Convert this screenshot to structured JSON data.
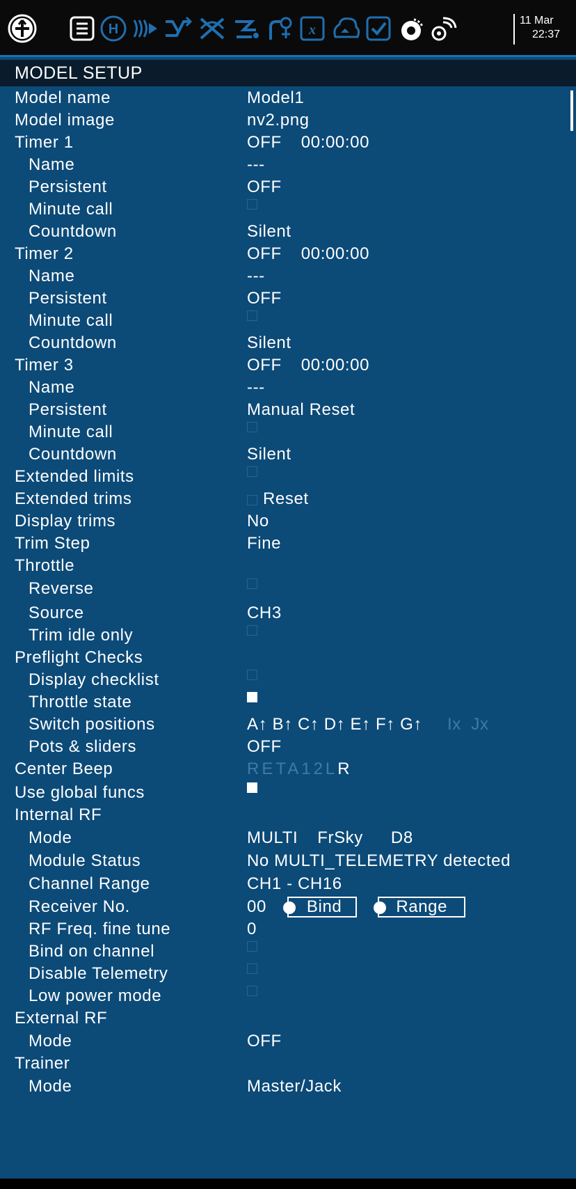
{
  "topbar": {
    "icons": [
      "radio-menu-icon",
      "model-menu-icon",
      "heli-icon",
      "outputs-icon",
      "mixes-icon",
      "curves-icon",
      "logical-switches-icon",
      "special-functions-icon",
      "gvars-icon",
      "lua-scripts-icon",
      "telemetry-icon",
      "checklist-icon",
      "display-icon",
      "telemetry-signal-icon"
    ],
    "date": "11 Mar",
    "time": "22:37"
  },
  "header": {
    "title": "MODEL SETUP"
  },
  "rows": [
    {
      "label": "Model name",
      "value": "Model1"
    },
    {
      "label": "Model image",
      "value": "nv2.png"
    },
    {
      "label": "Timer 1",
      "state": "OFF",
      "time": "00:00:00"
    },
    {
      "label": "Name",
      "value": "---"
    },
    {
      "label": "Persistent",
      "value": "OFF"
    },
    {
      "label": "Minute call",
      "checked": false
    },
    {
      "label": "Countdown",
      "value": "Silent"
    },
    {
      "label": "Timer 2",
      "state": "OFF",
      "time": "00:00:00"
    },
    {
      "label": "Name",
      "value": "---"
    },
    {
      "label": "Persistent",
      "value": "OFF"
    },
    {
      "label": "Minute call",
      "checked": false
    },
    {
      "label": "Countdown",
      "value": "Silent"
    },
    {
      "label": "Timer 3",
      "state": "OFF",
      "time": "00:00:00"
    },
    {
      "label": "Name",
      "value": "---"
    },
    {
      "label": "Persistent",
      "value": "Manual Reset"
    },
    {
      "label": "Minute call",
      "checked": false
    },
    {
      "label": "Countdown",
      "value": "Silent"
    },
    {
      "label": "Extended limits",
      "checked": false
    },
    {
      "label": "Extended trims",
      "checked": false,
      "button": "Reset"
    },
    {
      "label": "Display trims",
      "value": "No"
    },
    {
      "label": "Trim Step",
      "value": "Fine"
    },
    {
      "label": "Throttle"
    },
    {
      "label": "Reverse",
      "checked": false
    },
    {
      "label": "Source",
      "value": "CH3"
    },
    {
      "label": "Trim idle only",
      "checked": false
    },
    {
      "label": "Preflight Checks"
    },
    {
      "label": "Display checklist",
      "checked": false
    },
    {
      "label": "Throttle state",
      "checked": true
    },
    {
      "label": "Switch positions",
      "value": "A↑ B↑ C↑ D↑ E↑ F↑ G↑",
      "dim": "Ix  Jx"
    },
    {
      "label": "Pots & sliders",
      "value": "OFF"
    },
    {
      "label": "Center Beep",
      "dim": "RETA12L",
      "active": "R"
    },
    {
      "label": "Use global funcs",
      "checked": true
    },
    {
      "label": "Internal RF"
    },
    {
      "label": "Mode",
      "mode": "MULTI",
      "protocol": "FrSky",
      "subtype": "D8"
    },
    {
      "label": "Module Status",
      "value": "No MULTI_TELEMETRY detected"
    },
    {
      "label": "Channel Range",
      "value": "CH1 - CH16"
    },
    {
      "label": "Receiver No.",
      "value": "00",
      "bind": "Bind",
      "range": "Range"
    },
    {
      "label": "RF Freq. fine tune",
      "value": "0"
    },
    {
      "label": "Bind on channel",
      "checked": false
    },
    {
      "label": "Disable Telemetry",
      "checked": false
    },
    {
      "label": "Low power mode",
      "checked": false
    },
    {
      "label": "External RF"
    },
    {
      "label": "Mode",
      "value": "OFF"
    },
    {
      "label": "Trainer"
    },
    {
      "label": "Mode",
      "value": "Master/Jack"
    }
  ]
}
